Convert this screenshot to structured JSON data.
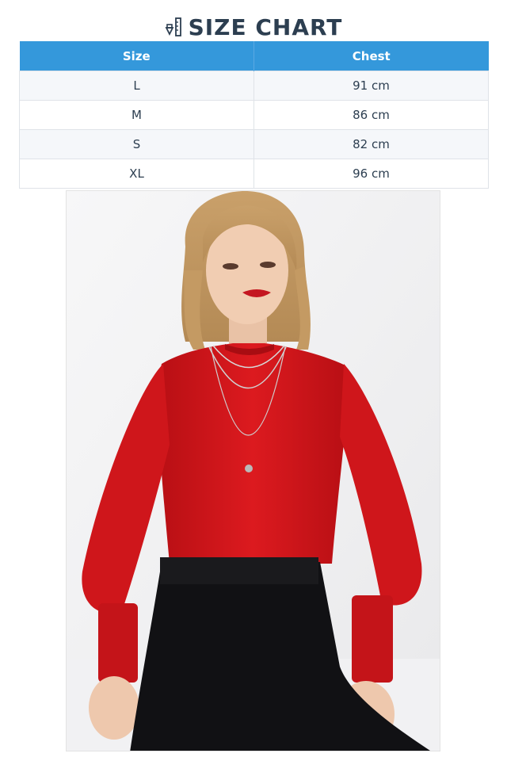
{
  "header": {
    "title": "SIZE CHART",
    "icon": "ruler-pencil-icon"
  },
  "table": {
    "columns": [
      "Size",
      "Chest"
    ],
    "rows": [
      {
        "size": "L",
        "chest": "91 cm"
      },
      {
        "size": "M",
        "chest": "86 cm"
      },
      {
        "size": "S",
        "chest": "82 cm"
      },
      {
        "size": "XL",
        "chest": "96 cm"
      }
    ]
  },
  "colors": {
    "header_bg": "#3498db",
    "title": "#2c3e50",
    "row_alt": "#f5f7fa",
    "garment": "#d8161b"
  },
  "product_image": {
    "subject": "model-in-red-top"
  }
}
